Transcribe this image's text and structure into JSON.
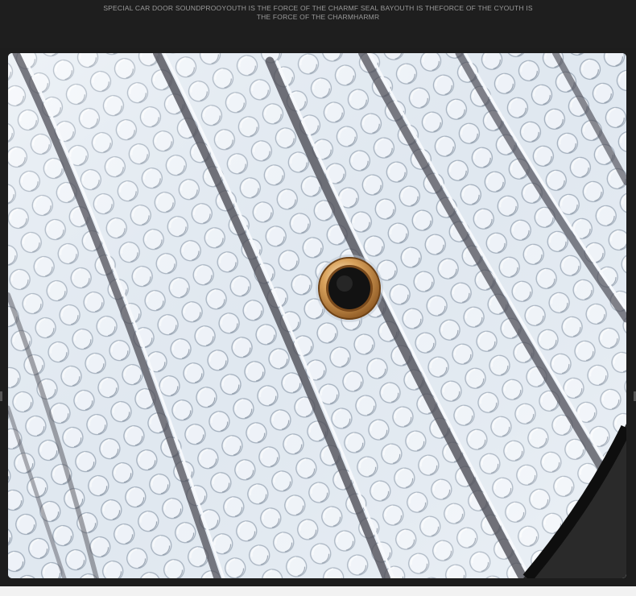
{
  "caption": {
    "line1": "SPECIAL CAR DOOR SOUNDPROOYOUTH IS THE FORCE OF THE CHARMF SEAL BAYOUTH IS THEFORCE OF THE CYOUTH IS",
    "line2": "THE FORCE OF THE CHARMHARMR"
  },
  "colors": {
    "page_background": "#1d1d1d",
    "foil_silver": "#d9e4ee",
    "crease_dark": "#4a4a52",
    "grommet_brass": "#c98a45",
    "grommet_hole": "#141414",
    "binding_edge": "#111111"
  },
  "photo": {
    "subject": "foil-bubble-insulation",
    "feature_icon": "grommet-eyelet-icon"
  }
}
